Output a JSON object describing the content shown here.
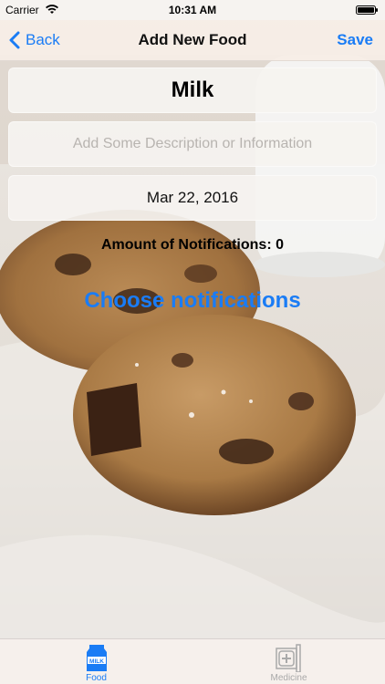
{
  "status_bar": {
    "carrier": "Carrier",
    "time": "10:31 AM",
    "icons": [
      "wifi-icon",
      "battery-icon"
    ]
  },
  "nav": {
    "back_label": "Back",
    "title": "Add New Food",
    "save_label": "Save"
  },
  "form": {
    "name_value": "Milk",
    "description_placeholder": "Add Some Description or Information",
    "date_value": "Mar 22, 2016",
    "notification_count_text": "Amount of Notifications: 0",
    "choose_notifications_label": "Choose notifications"
  },
  "tab_bar": {
    "items": [
      {
        "label": "Food",
        "icon": "milk-carton-icon",
        "icon_text": "MILK",
        "selected": true
      },
      {
        "label": "Medicine",
        "icon": "medicine-box-icon",
        "selected": false
      }
    ]
  },
  "colors": {
    "accent": "#1a7cf5",
    "tab_inactive": "#a9a9a9"
  }
}
